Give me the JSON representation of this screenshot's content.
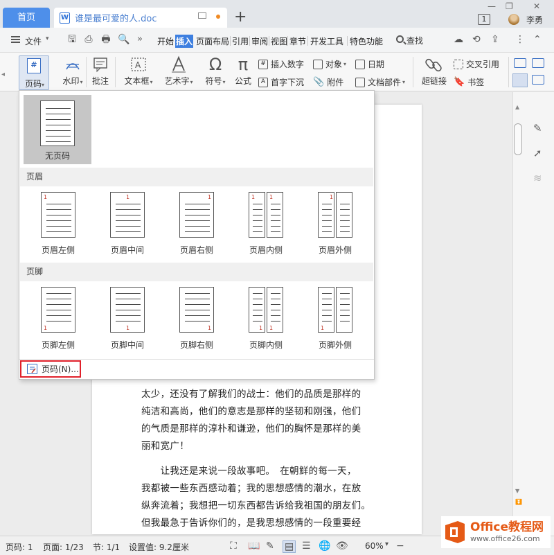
{
  "titlebar": {
    "home_tab": "首页",
    "doc_tab": "谁是最可爱的人.doc",
    "doc_icon": "W",
    "new_tab": "+",
    "badge": "1",
    "username": "李勇"
  },
  "menubar": {
    "file": "文件",
    "tabs": [
      "开始",
      "插入",
      "页面布局",
      "引用",
      "审阅",
      "视图",
      "章节",
      "开发工具",
      "特色功能"
    ],
    "active_tab": "插入",
    "search": "查找"
  },
  "ribbon": {
    "page_number": "页码",
    "watermark": "水印",
    "comment": "批注",
    "textbox": "文本框",
    "wordart": "艺术字",
    "symbol": "符号",
    "formula": "公式",
    "insert_number": "插入数字",
    "object": "对象",
    "date": "日期",
    "drop_cap": "首字下沉",
    "attachment": "附件",
    "doc_parts": "文档部件",
    "hyperlink": "超链接",
    "cross_ref": "交叉引用",
    "bookmark": "书签"
  },
  "dropdown": {
    "none_label": "无页码",
    "header_section": "页眉",
    "footer_section": "页脚",
    "header_options": [
      "页眉左侧",
      "页眉中间",
      "页眉右侧",
      "页眉内侧",
      "页眉外侧"
    ],
    "footer_options": [
      "页脚左侧",
      "页脚中间",
      "页脚右侧",
      "页脚内侧",
      "页脚外侧"
    ],
    "page_number_item": "页码(N)...",
    "thumb_number": "1"
  },
  "document": {
    "paragraphs": [
      "太少，还没有了解我们的战士：他们的品质是那样的",
      "纯洁和高尚，他们的意志是那样的坚韧和刚强，他们",
      "的气质是那样的淳朴和谦逊，他们的胸怀是那样的美",
      "丽和宽广！",
      "　　让我还是来说一段故事吧。　在朝鲜的每一天，",
      "我都被一些东西感动着；我的思想感情的潮水，在放",
      "纵奔流着；我想把一切东西都告诉给我祖国的朋友们。",
      "但我最急于告诉你们的，是我思想感情的一段重要经"
    ]
  },
  "statusbar": {
    "page_code": "页码: 1",
    "page": "页面: 1/23",
    "section": "节: 1/1",
    "setting": "设置值: 9.2厘米",
    "zoom": "60%"
  },
  "logo": {
    "name": "Office教程网",
    "url": "www.office26.com"
  },
  "colors": {
    "accent": "#3d7fe0",
    "highlight_border": "#e0202a",
    "logo_orange": "#e55a16"
  }
}
